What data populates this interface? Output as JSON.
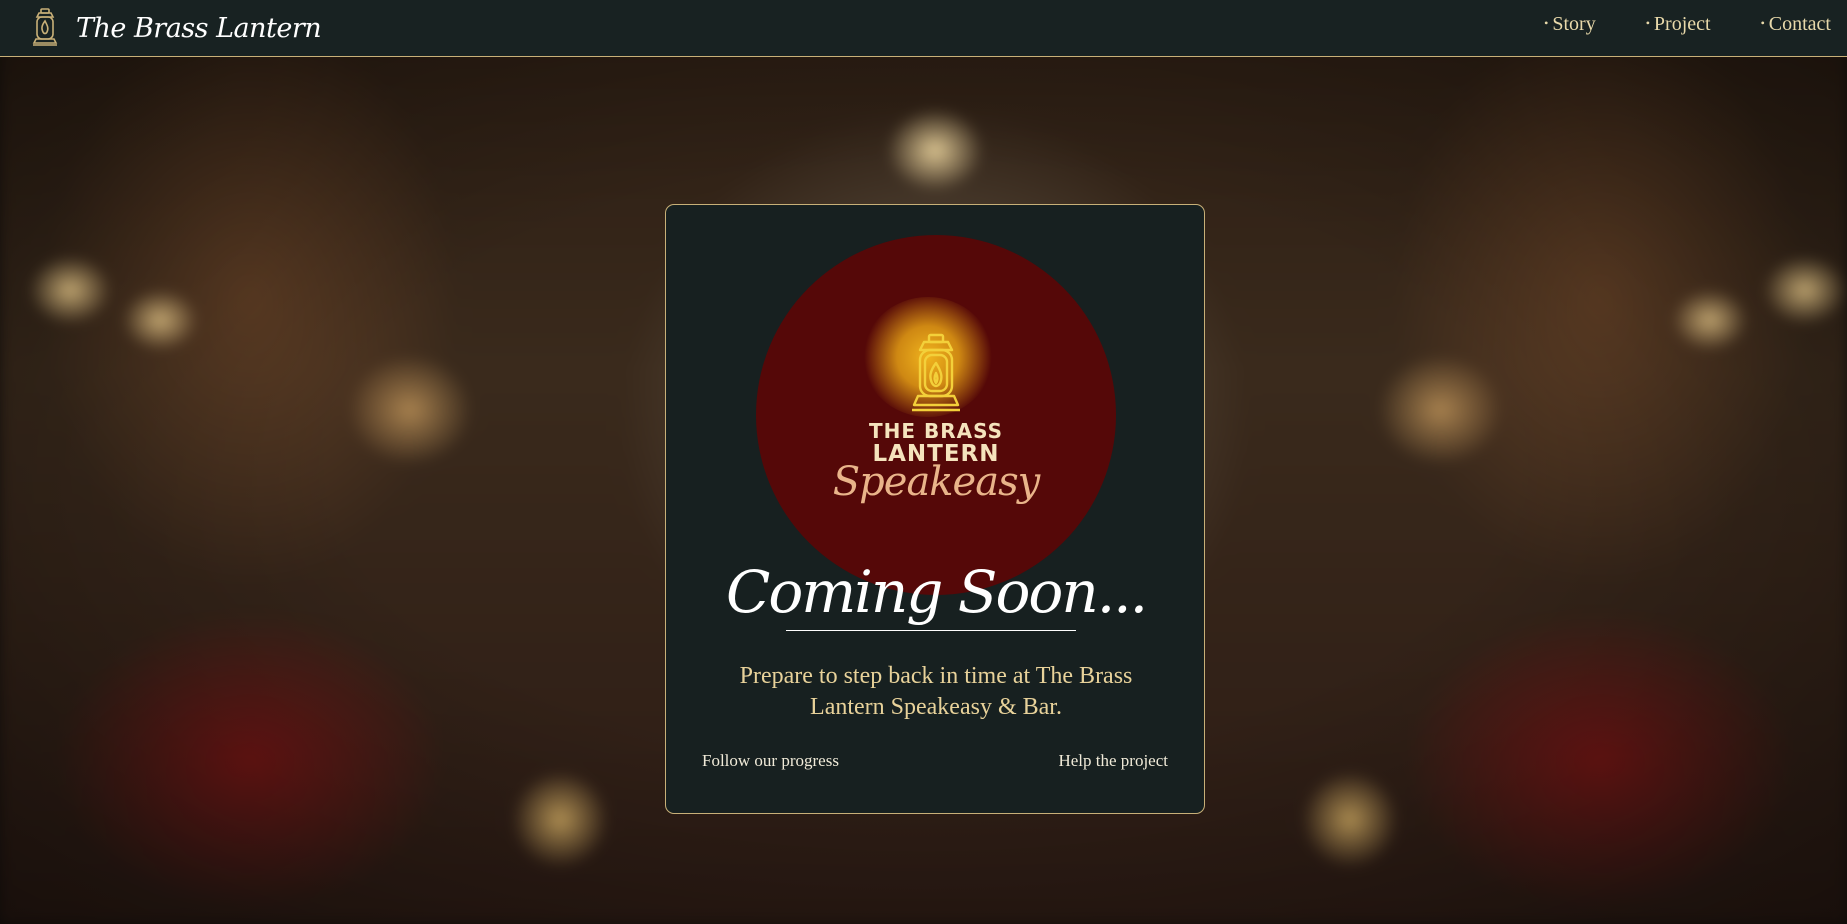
{
  "header": {
    "brand_name": "The Brass Lantern",
    "brand_icon": "lantern-icon",
    "nav": [
      {
        "bullet": "•",
        "label": "Story"
      },
      {
        "bullet": "•",
        "label": "Project"
      },
      {
        "bullet": "•",
        "label": "Contact"
      }
    ]
  },
  "card": {
    "logo": {
      "line1": "THE BRASS",
      "line2": "LANTERN",
      "script": "Speakeasy",
      "icon": "lantern-icon"
    },
    "headline": "Coming Soon...",
    "tagline": "Prepare to step back in time at The Brass Lantern Speakeasy & Bar.",
    "link_left": "Follow our progress",
    "link_right": "Help the project"
  },
  "colors": {
    "navbar_bg": "#182222",
    "card_bg": "#172020",
    "gold_border": "#c8b078",
    "logo_circle": "#550808",
    "nav_text": "#e8d9aa",
    "tagline_text": "#e8d29a"
  }
}
